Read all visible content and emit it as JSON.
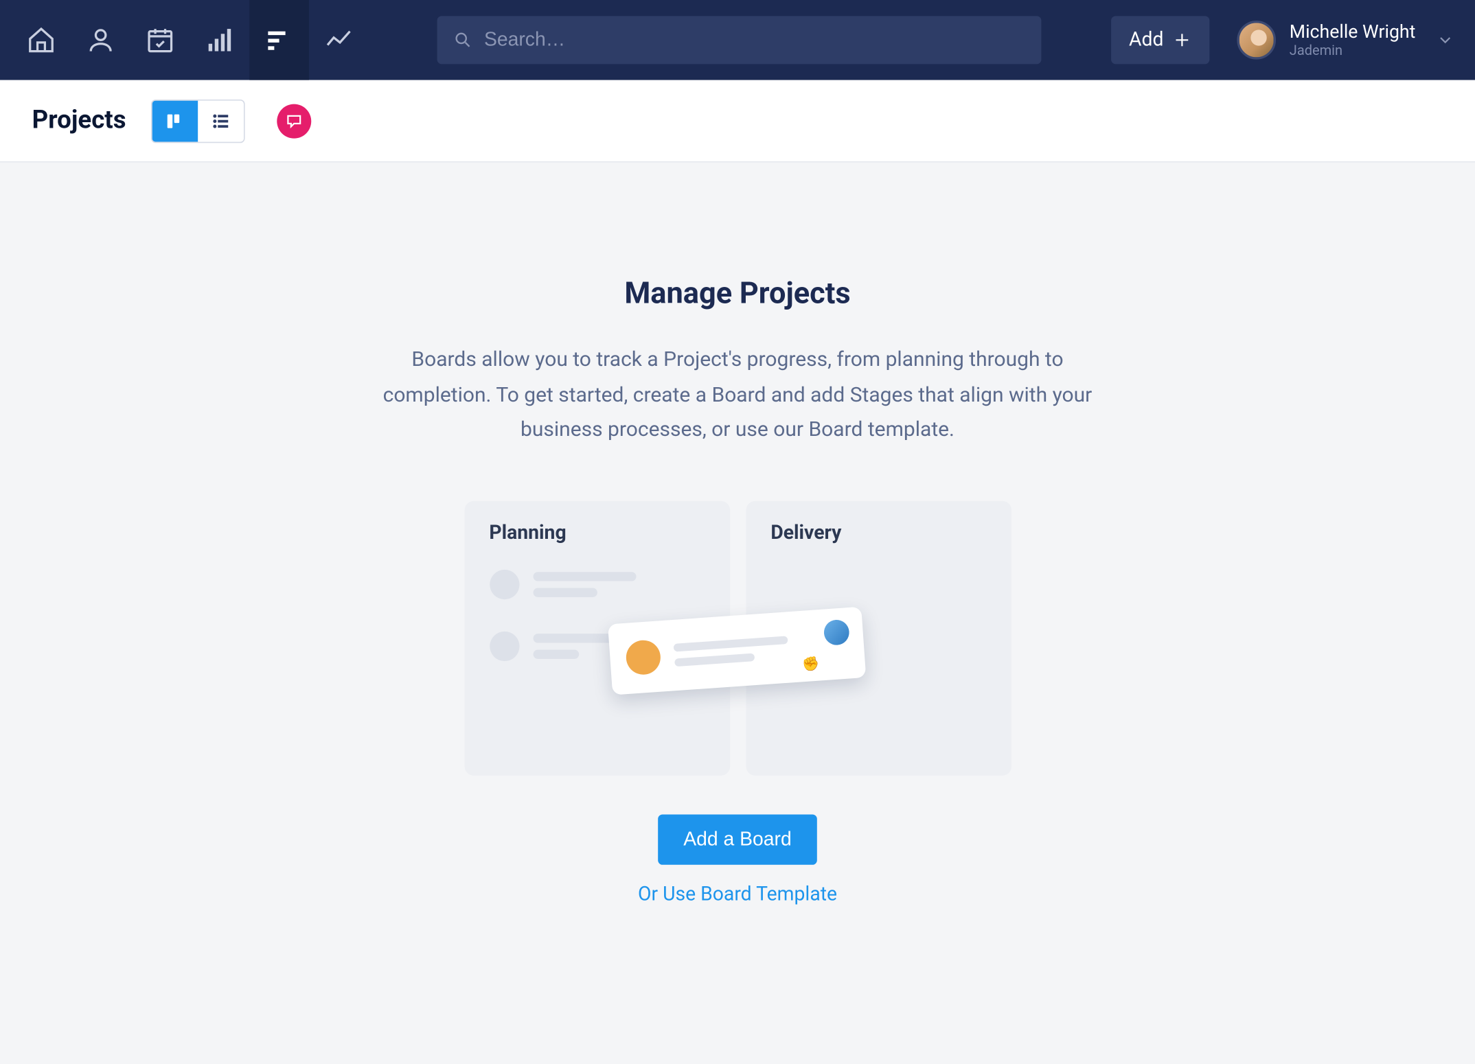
{
  "nav": {
    "search_placeholder": "Search…",
    "add_label": "Add",
    "user_name": "Michelle Wright",
    "user_sub": "Jademin"
  },
  "secondary": {
    "title": "Projects"
  },
  "empty_state": {
    "headline": "Manage Projects",
    "description": "Boards allow you to track a Project's progress, from planning through to completion. To get started, create a Board and add Stages that align with your business processes, or use our Board template.",
    "illus_left_title": "Planning",
    "illus_right_title": "Delivery",
    "primary_button": "Add a Board",
    "template_link": "Or Use Board Template"
  }
}
